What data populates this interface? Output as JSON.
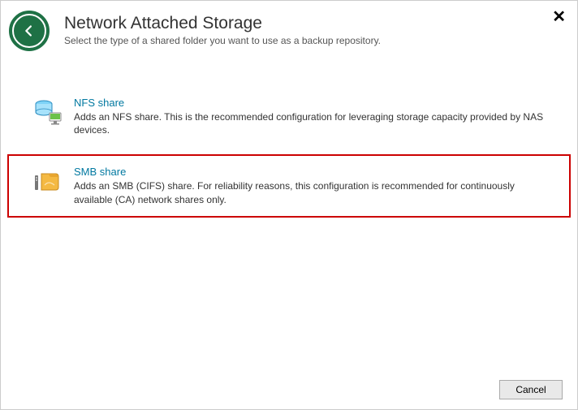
{
  "header": {
    "title": "Network Attached Storage",
    "subtitle": "Select the type of a shared folder you want to use as a backup repository."
  },
  "options": [
    {
      "icon": "nfs-share-icon",
      "title": "NFS share",
      "desc": "Adds an NFS share. This is the recommended configuration for leveraging storage capacity provided by NAS devices.",
      "selected": false
    },
    {
      "icon": "smb-share-icon",
      "title": "SMB share",
      "desc": "Adds an SMB (CIFS) share. For reliability reasons, this configuration is recommended for continuously available (CA) network shares only.",
      "selected": true
    }
  ],
  "footer": {
    "cancel_label": "Cancel"
  }
}
